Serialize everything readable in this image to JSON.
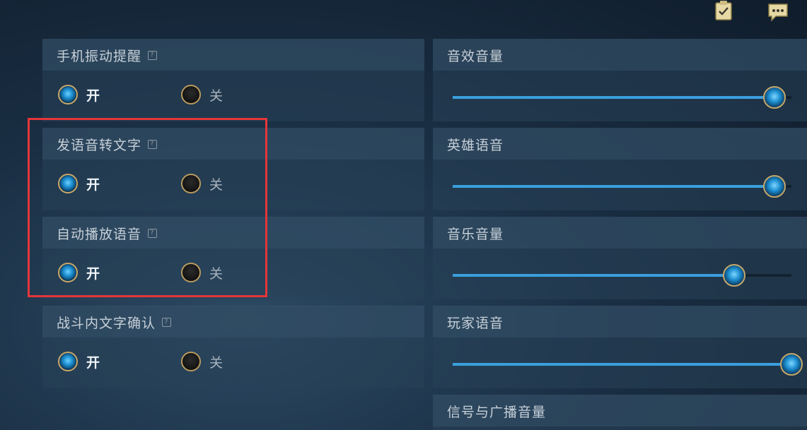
{
  "top_icons": [
    "checklist-icon",
    "chat-icon"
  ],
  "toggles": [
    {
      "label": "手机振动提醒",
      "on": "开",
      "off": "关",
      "selected": "on"
    },
    {
      "label": "发语音转文字",
      "on": "开",
      "off": "关",
      "selected": "on"
    },
    {
      "label": "自动播放语音",
      "on": "开",
      "off": "关",
      "selected": "on"
    },
    {
      "label": "战斗内文字确认",
      "on": "开",
      "off": "关",
      "selected": "on"
    }
  ],
  "volumes": [
    {
      "label": "音效音量",
      "value": 0.95
    },
    {
      "label": "英雄语音",
      "value": 0.95
    },
    {
      "label": "音乐音量",
      "value": 0.83
    },
    {
      "label": "玩家语音",
      "value": 1.0
    },
    {
      "label": "信号与广播音量",
      "value": null
    }
  ],
  "colors": {
    "accent": "#3a9fdc",
    "highlight": "#e4363a",
    "gold": "#c7a76a"
  }
}
